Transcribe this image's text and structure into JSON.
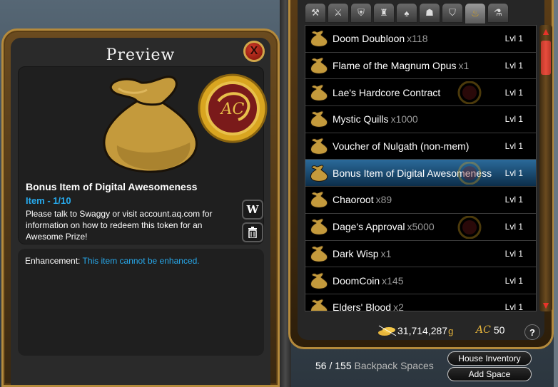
{
  "preview": {
    "title": "Preview",
    "close_label": "X",
    "item_name": "Bonus Item of Digital Awesomeness",
    "item_type": "Item - 1/10",
    "description": "Please talk to Swaggy or visit account.aq.com for information on how to redeem this token for an Awesome Prize!",
    "wiki_label": "W",
    "coin_text": "AC",
    "enhancement_label": "Enhancement:",
    "enhancement_value": "This item cannot be enhanced."
  },
  "tabs": [
    {
      "icon": "weapon-tab-icon"
    },
    {
      "icon": "sword-tab-icon"
    },
    {
      "icon": "armor-tab-icon"
    },
    {
      "icon": "helm-tab-icon"
    },
    {
      "icon": "cape-tab-icon"
    },
    {
      "icon": "pet-tab-icon"
    },
    {
      "icon": "shield-tab-icon"
    },
    {
      "icon": "bag-tab-icon",
      "active": true
    },
    {
      "icon": "potion-tab-icon"
    }
  ],
  "items": [
    {
      "name": "Doom Doubloon",
      "qty": "x118",
      "lvl": "Lvl 1",
      "selected": false,
      "ac": false
    },
    {
      "name": "Flame of the Magnum Opus",
      "qty": "x1",
      "lvl": "Lvl 1",
      "selected": false,
      "ac": false
    },
    {
      "name": "Lae's Hardcore Contract",
      "qty": "",
      "lvl": "Lvl 1",
      "selected": false,
      "ac": true
    },
    {
      "name": "Mystic Quills",
      "qty": "x1000",
      "lvl": "Lvl 1",
      "selected": false,
      "ac": false
    },
    {
      "name": "Voucher of Nulgath (non-mem)",
      "qty": "",
      "lvl": "Lvl 1",
      "selected": false,
      "ac": false
    },
    {
      "name": "Bonus Item of Digital Awesomeness",
      "qty": "",
      "lvl": "Lvl 1",
      "selected": true,
      "ac": true
    },
    {
      "name": "Chaoroot",
      "qty": "x89",
      "lvl": "Lvl 1",
      "selected": false,
      "ac": false
    },
    {
      "name": "Dage's Approval",
      "qty": "x5000",
      "lvl": "Lvl 1",
      "selected": false,
      "ac": true
    },
    {
      "name": "Dark Wisp",
      "qty": "x1",
      "lvl": "Lvl 1",
      "selected": false,
      "ac": false
    },
    {
      "name": "DoomCoin",
      "qty": "x145",
      "lvl": "Lvl 1",
      "selected": false,
      "ac": false
    },
    {
      "name": "Elders' Blood",
      "qty": "x2",
      "lvl": "Lvl 1",
      "selected": false,
      "ac": false
    }
  ],
  "currency": {
    "gold": "31,714,287",
    "gold_unit": "g",
    "ac_label": "AC",
    "ac": "50",
    "help": "?"
  },
  "backpack": {
    "count": "56 / 155",
    "label": "Backpack Spaces"
  },
  "buttons": {
    "house_inventory": "House Inventory",
    "add_space": "Add Space"
  },
  "colors": {
    "accent_blue": "#27a9ec",
    "gold_frame": "#b48a3c",
    "selected_row": "#2b6a9a",
    "scroll_red": "#e74c3c"
  }
}
